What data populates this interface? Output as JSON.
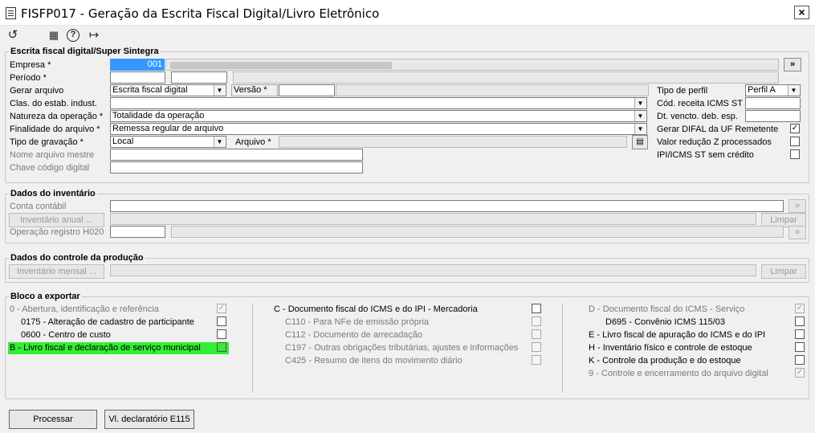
{
  "window": {
    "title": "FISFP017 - Geração da Escrita Fiscal Digital/Livro Eletrônico",
    "close": "×"
  },
  "toolbar": {
    "undo": "↺",
    "calendar": "▦",
    "help": "?",
    "exit": "↦"
  },
  "sped": {
    "title": "Escrita fiscal digital/Super Sintegra",
    "empresa": {
      "label": "Empresa *",
      "value": "001",
      "lookup": "»"
    },
    "periodo": {
      "label": "Período *"
    },
    "gerar_arquivo": {
      "label": "Gerar arquivo",
      "value": "Escrita fiscal digital"
    },
    "versao": {
      "label": "Versão *"
    },
    "clas_estab": {
      "label": "Clas. do estab. indust."
    },
    "natureza": {
      "label": "Natureza da operação *",
      "value": "Totalidade da operação"
    },
    "finalidade": {
      "label": "Finalidade do arquivo *",
      "value": "Remessa regular de arquivo"
    },
    "tipo_gravacao": {
      "label": "Tipo de gravação *",
      "value": "Local"
    },
    "arquivo": {
      "label": "Arquivo *"
    },
    "nome_mestre": {
      "label": "Nome arquivo mestre"
    },
    "chave_codigo": {
      "label": "Chave código digital"
    },
    "tipo_perfil": {
      "label": "Tipo de perfil",
      "value": "Perfil A"
    },
    "cod_receita": {
      "label": "Cód. receita ICMS ST"
    },
    "dt_vencto": {
      "label": "Dt. vencto. deb. esp."
    },
    "gerar_difal": {
      "label": "Gerar DIFAL da UF Remetente",
      "checked": "✓"
    },
    "valor_reducao": {
      "label": "Valor redução Z processados"
    },
    "ipi_icms": {
      "label": "IPI/ICMS ST sem crédito"
    }
  },
  "inventario": {
    "title": "Dados do inventário",
    "conta": {
      "label": "Conta contábil"
    },
    "anual_btn": "Inventário anual ...",
    "limpar": "Limpar",
    "operacao": {
      "label": "Operação registro H020"
    },
    "lookup": "»"
  },
  "producao": {
    "title": "Dados do controle da produção",
    "mensal_btn": "Inventário mensal ...",
    "limpar": "Limpar"
  },
  "bloco": {
    "title": "Bloco a exportar",
    "col1": [
      {
        "label": "0 - Abertura, identificação e referência",
        "checked": "✓"
      },
      {
        "label": "0175 - Alteração de cadastro de participante",
        "checked": ""
      },
      {
        "label": "0600 - Centro de custo",
        "checked": ""
      },
      {
        "label": "B - Livro fiscal e declaração de serviço municipal",
        "checked": ""
      }
    ],
    "col2": [
      {
        "label": "C - Documento fiscal do ICMS e do IPI - Mercadoria",
        "checked": ""
      },
      {
        "label": "C110 - Para NFe de emissão própria",
        "checked": ""
      },
      {
        "label": "C112 - Documento de arrecadação",
        "checked": ""
      },
      {
        "label": "C197 - Outras obrigações tributárias, ajustes e informações",
        "checked": ""
      },
      {
        "label": "C425 - Resumo de itens do movimento diário",
        "checked": ""
      }
    ],
    "col3": [
      {
        "label": "D - Documento fiscal do ICMS - Serviço",
        "checked": "✓"
      },
      {
        "label": "D695 - Convênio ICMS 115/03",
        "checked": ""
      },
      {
        "label": "E - Livro fiscal de apuração do ICMS e do IPI",
        "checked": ""
      },
      {
        "label": "H - Inventário físico e controle de estoque",
        "checked": ""
      },
      {
        "label": "K - Controle da produção e do estoque",
        "checked": ""
      },
      {
        "label": "9 - Controle e encerramento do arquivo digital",
        "checked": "✓"
      }
    ]
  },
  "footer": {
    "processar": "Processar",
    "vl_declaratorio": "Vl. declaratório E115"
  },
  "colors": {
    "highlight": "#33ee33",
    "selection": "#3399ff"
  }
}
